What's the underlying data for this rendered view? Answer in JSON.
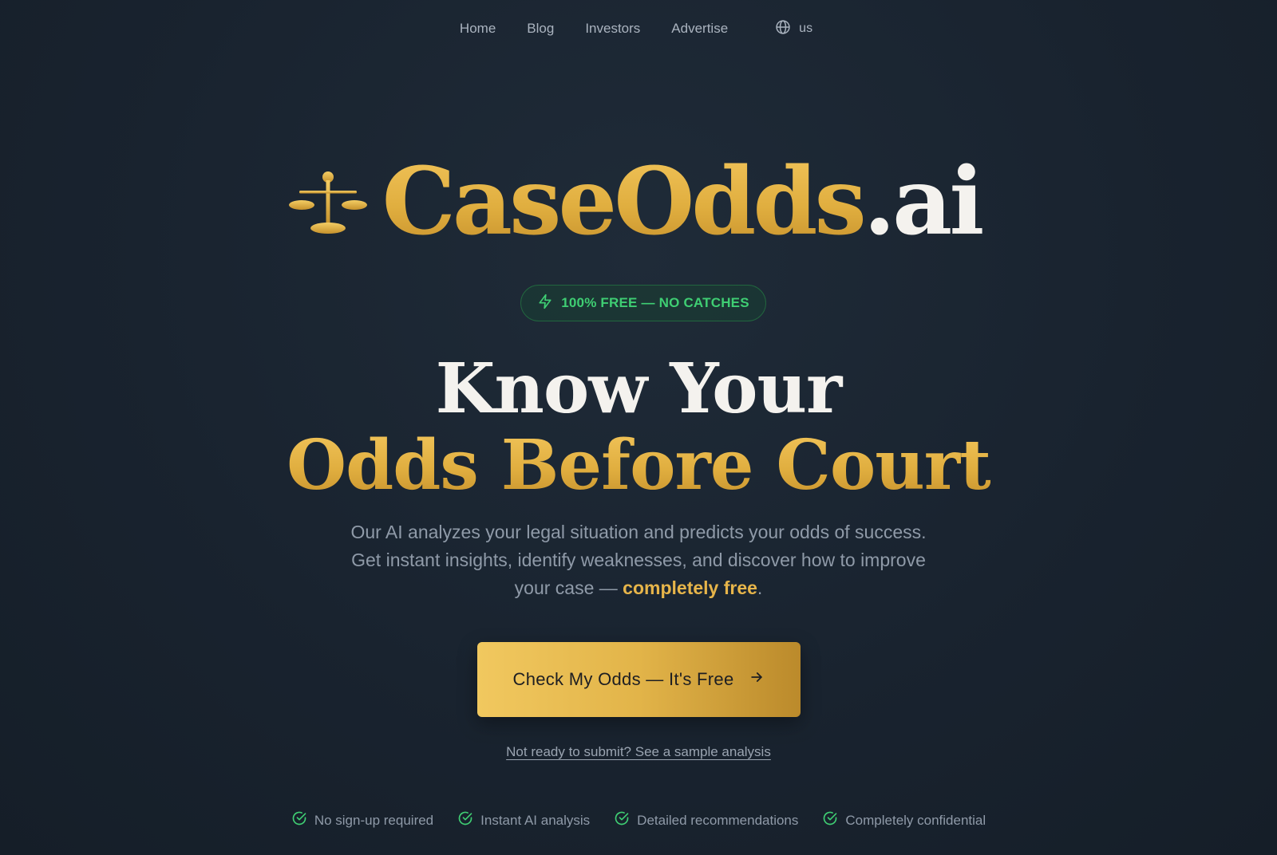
{
  "nav": {
    "links": [
      "Home",
      "Blog",
      "Investors",
      "Advertise"
    ],
    "locale": "us"
  },
  "brand": {
    "name_main": "CaseOdds",
    "name_suffix": ".ai",
    "logo_icon": "scales-icon"
  },
  "badge": {
    "icon": "lightning-icon",
    "text": "100% FREE — NO CATCHES"
  },
  "headline": {
    "line1": "Know Your",
    "line2": "Odds Before Court"
  },
  "subtitle": {
    "line1": "Our AI analyzes your legal situation and predicts your odds of success.",
    "line2": "Get instant insights, identify weaknesses, and discover how to improve",
    "line3_prefix": "your case — ",
    "line3_highlight": "completely free",
    "line3_suffix": "."
  },
  "cta": {
    "label": "Check My Odds — It's Free",
    "icon": "arrow-right-icon"
  },
  "sample_link": "Not ready to submit? See a sample analysis",
  "features": [
    "No sign-up required",
    "Instant AI analysis",
    "Detailed recommendations",
    "Completely confidential"
  ],
  "colors": {
    "background": "#19232f",
    "gold": "#e2b449",
    "green": "#3fce73",
    "muted_text": "#8f9aa8"
  }
}
